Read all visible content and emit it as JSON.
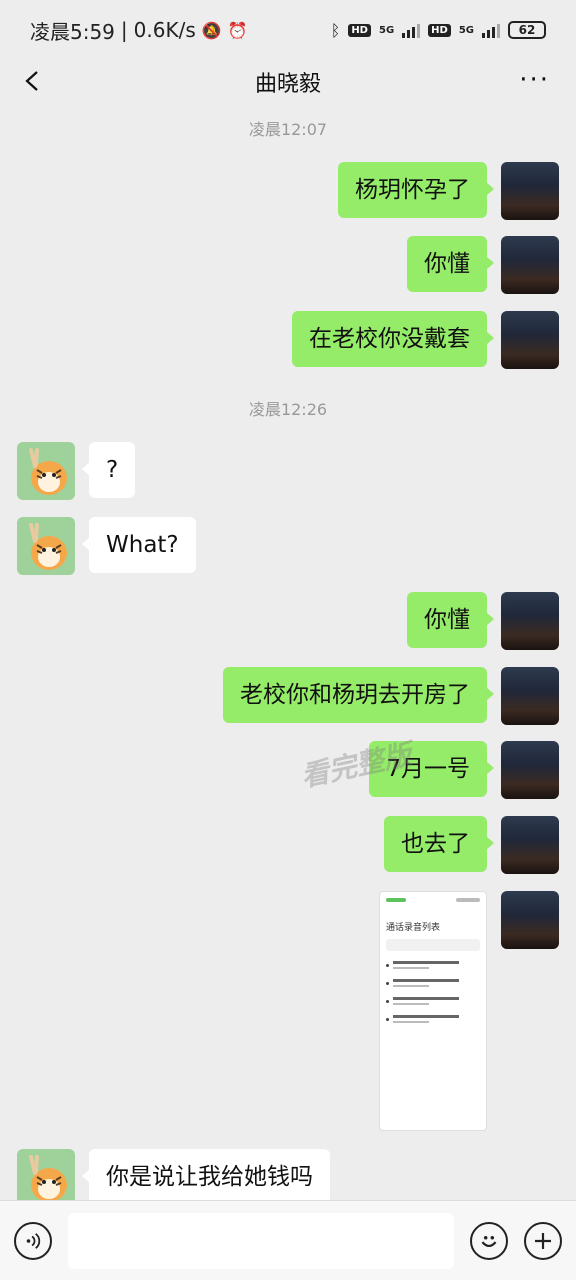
{
  "status_bar": {
    "time": "凌晨5:59",
    "speed": "0.6K/s",
    "hd1": "HD",
    "net1": "5G",
    "hd2": "HD",
    "net2": "5G",
    "battery": "62"
  },
  "header": {
    "title": "曲晓毅"
  },
  "chat": {
    "timestamps": [
      "凌晨12:07",
      "凌晨12:26"
    ],
    "messages": [
      {
        "side": "right",
        "text": "杨玥怀孕了"
      },
      {
        "side": "right",
        "text": "你懂"
      },
      {
        "side": "right",
        "text": "在老校你没戴套"
      },
      {
        "side": "left",
        "text": "?"
      },
      {
        "side": "left",
        "text": "What?"
      },
      {
        "side": "right",
        "text": "你懂"
      },
      {
        "side": "right",
        "text": "老校你和杨玥去开房了"
      },
      {
        "side": "right",
        "text": "7月一号"
      },
      {
        "side": "right",
        "text": "也去了"
      },
      {
        "side": "left",
        "text": "你是说让我给她钱吗"
      }
    ],
    "screenshot_title": "通话录音列表",
    "watermark": "看完整版"
  },
  "icons": [
    "back-icon",
    "more-icon",
    "voice-icon",
    "emoji-icon",
    "plus-icon"
  ]
}
